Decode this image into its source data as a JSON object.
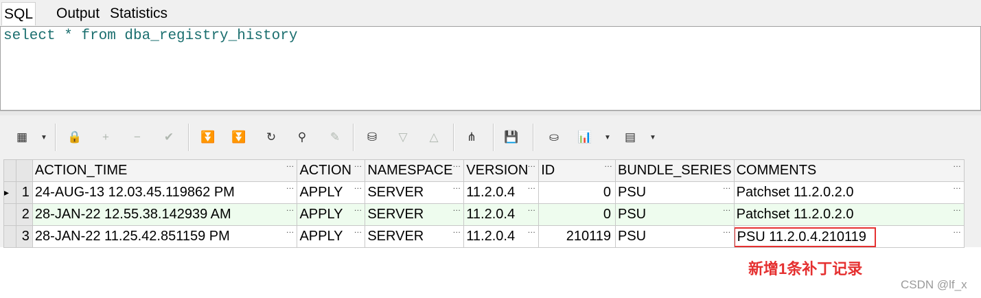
{
  "tabs": [
    {
      "label": "SQL",
      "active": true
    },
    {
      "label": "Output",
      "active": false
    },
    {
      "label": "Statistics",
      "active": false
    }
  ],
  "editor": {
    "sql": "select * from dba_registry_history"
  },
  "toolbar": {
    "icons": [
      "grid-view-icon",
      "lock-icon",
      "insert-record-icon",
      "delete-record-icon",
      "post-edit-icon",
      "next-page-icon",
      "last-page-icon",
      "refresh-icon",
      "find-icon",
      "clear-icon",
      "query-by-example-icon",
      "sort-descending-icon",
      "sort-ascending-icon",
      "explain-plan-icon",
      "save-icon",
      "export-icon",
      "chart-icon",
      "single-record-view-icon"
    ]
  },
  "grid": {
    "columns": [
      "ACTION_TIME",
      "ACTION",
      "NAMESPACE",
      "VERSION",
      "ID",
      "BUNDLE_SERIES",
      "COMMENTS"
    ],
    "rows": [
      {
        "num": "1",
        "cells": [
          "24-AUG-13 12.03.45.119862 PM",
          "APPLY",
          "SERVER",
          "11.2.0.4",
          "0",
          "PSU",
          "Patchset 11.2.0.2.0"
        ]
      },
      {
        "num": "2",
        "cells": [
          "28-JAN-22 12.55.38.142939 AM",
          "APPLY",
          "SERVER",
          "11.2.0.4",
          "0",
          "PSU",
          "Patchset 11.2.0.2.0"
        ]
      },
      {
        "num": "3",
        "cells": [
          "28-JAN-22 11.25.42.851159 PM",
          "APPLY",
          "SERVER",
          "11.2.0.4",
          "210119",
          "PSU",
          "PSU 11.2.0.4.210119"
        ]
      }
    ],
    "current_row_marker": "▸"
  },
  "annotation": {
    "text": "新增1条补丁记录",
    "color": "#e53030"
  },
  "watermark": "CSDN @lf_x"
}
